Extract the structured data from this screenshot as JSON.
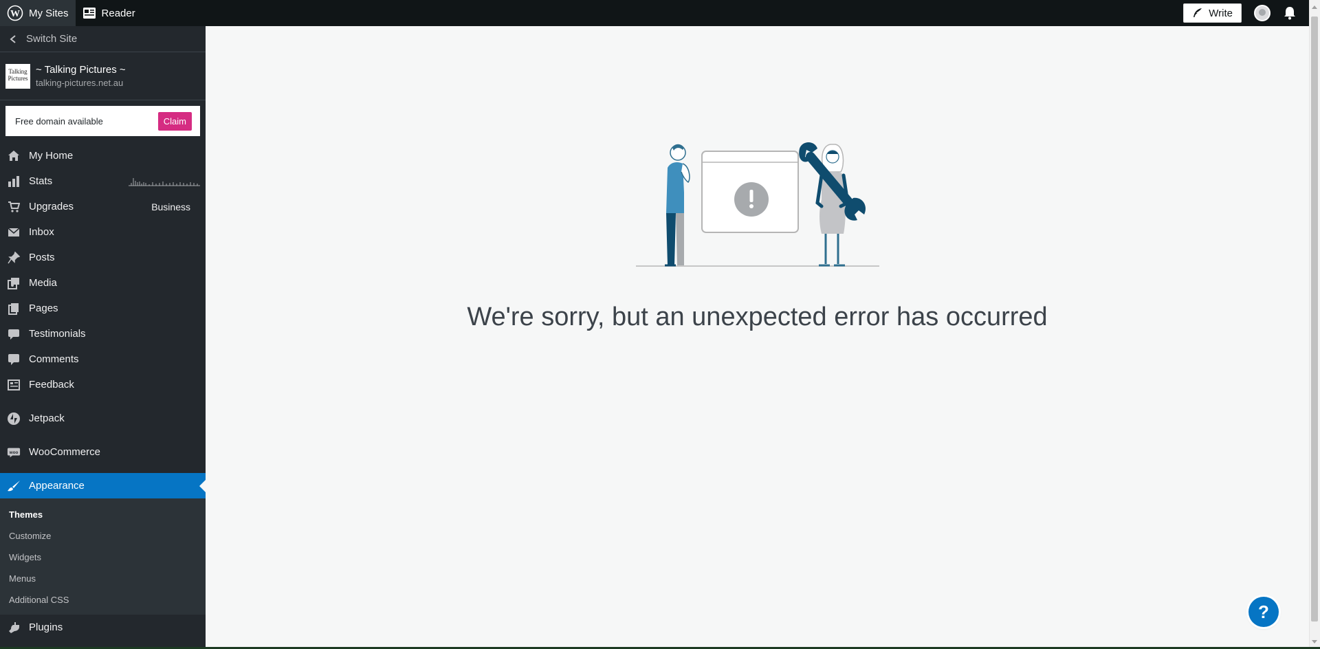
{
  "topbar": {
    "my_sites": "My Sites",
    "reader": "Reader",
    "write": "Write"
  },
  "sidebar": {
    "switch_site": "Switch Site",
    "site": {
      "name": "~ Talking Pictures ~",
      "url": "talking-pictures.net.au",
      "icon_text": "Talking Pictures"
    },
    "domain_banner": {
      "text": "Free domain available",
      "button": "Claim"
    },
    "items": [
      {
        "label": "My Home",
        "icon": "home-icon"
      },
      {
        "label": "Stats",
        "icon": "stats-icon"
      },
      {
        "label": "Upgrades",
        "icon": "cart-icon",
        "extra": "Business"
      },
      {
        "label": "Inbox",
        "icon": "mail-icon"
      },
      {
        "label": "Posts",
        "icon": "pin-icon"
      },
      {
        "label": "Media",
        "icon": "media-icon"
      },
      {
        "label": "Pages",
        "icon": "pages-icon"
      },
      {
        "label": "Testimonials",
        "icon": "quote-icon"
      },
      {
        "label": "Comments",
        "icon": "comment-icon"
      },
      {
        "label": "Feedback",
        "icon": "feedback-icon"
      },
      {
        "label": "Jetpack",
        "icon": "jetpack-icon"
      },
      {
        "label": "WooCommerce",
        "icon": "woo-icon"
      },
      {
        "label": "Appearance",
        "icon": "brush-icon"
      },
      {
        "label": "Plugins",
        "icon": "plug-icon"
      }
    ],
    "appearance_submenu": [
      "Themes",
      "Customize",
      "Widgets",
      "Menus",
      "Additional CSS"
    ]
  },
  "main": {
    "error_message": "We're sorry, but an unexpected error has occurred"
  },
  "colors": {
    "accent": "#0675c4",
    "claim": "#d52c82",
    "sidebar_bg": "#23282d",
    "topbar_bg": "#101517"
  }
}
